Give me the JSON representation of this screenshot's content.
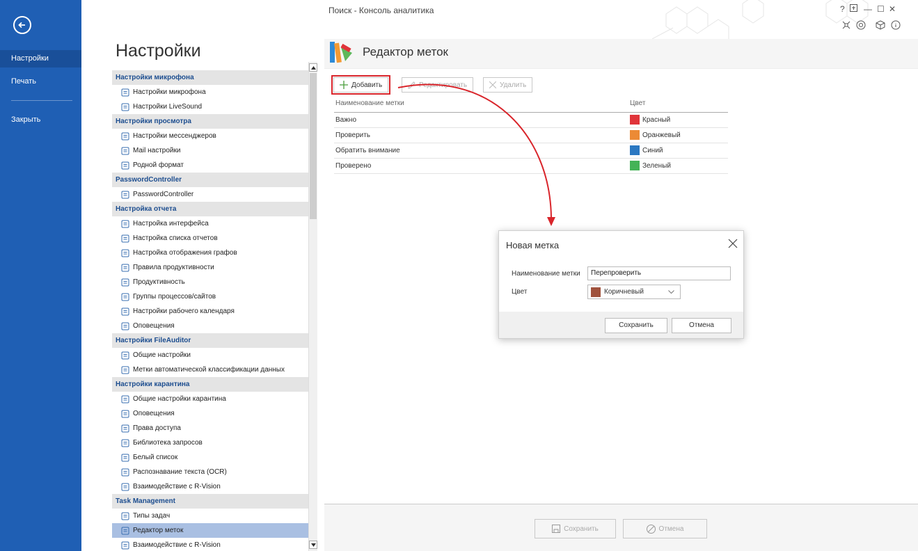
{
  "window": {
    "title": "Поиск - Консоль аналитика",
    "controls": [
      "?",
      "—",
      "☐",
      "✕"
    ]
  },
  "sidebar": {
    "items": [
      {
        "label": "Настройки"
      },
      {
        "label": "Печать"
      },
      {
        "label": "Закрыть"
      }
    ]
  },
  "settings": {
    "title": "Настройки",
    "tree": [
      {
        "type": "group",
        "label": "Настройки микрофона"
      },
      {
        "type": "item",
        "label": "Настройки микрофона",
        "icon": "microphone-icon"
      },
      {
        "type": "item",
        "label": "Настройки LiveSound",
        "icon": "livesound-icon"
      },
      {
        "type": "group",
        "label": "Настройки просмотра"
      },
      {
        "type": "item",
        "label": "Настройки мессенджеров",
        "icon": "messenger-icon"
      },
      {
        "type": "item",
        "label": "Mail настройки",
        "icon": "mail-icon"
      },
      {
        "type": "item",
        "label": "Родной формат",
        "icon": "format-icon"
      },
      {
        "type": "group",
        "label": "PasswordController"
      },
      {
        "type": "item",
        "label": "PasswordController",
        "icon": "lock-icon"
      },
      {
        "type": "group",
        "label": "Настройка отчета"
      },
      {
        "type": "item",
        "label": "Настройка интерфейса",
        "icon": "interface-icon"
      },
      {
        "type": "item",
        "label": "Настройка списка отчетов",
        "icon": "report-list-icon"
      },
      {
        "type": "item",
        "label": "Настройка отображения графов",
        "icon": "graph-icon"
      },
      {
        "type": "item",
        "label": "Правила продуктивности",
        "icon": "rules-icon"
      },
      {
        "type": "item",
        "label": "Продуктивность",
        "icon": "clock-icon"
      },
      {
        "type": "item",
        "label": "Группы процессов/сайтов",
        "icon": "groups-icon"
      },
      {
        "type": "item",
        "label": "Настройки рабочего календаря",
        "icon": "calendar-icon"
      },
      {
        "type": "item",
        "label": "Оповещения",
        "icon": "notification-icon"
      },
      {
        "type": "group",
        "label": "Настройки FileAuditor"
      },
      {
        "type": "item",
        "label": "Общие настройки",
        "icon": "settings-icon"
      },
      {
        "type": "item",
        "label": "Метки автоматической классификации данных",
        "icon": "tag-icon"
      },
      {
        "type": "group",
        "label": "Настройки карантина"
      },
      {
        "type": "item",
        "label": "Общие настройки карантина",
        "icon": "quarantine-icon"
      },
      {
        "type": "item",
        "label": "Оповещения",
        "icon": "notification-icon"
      },
      {
        "type": "item",
        "label": "Права доступа",
        "icon": "access-icon"
      },
      {
        "type": "item",
        "label": "Библиотека запросов",
        "icon": "library-icon"
      },
      {
        "type": "item",
        "label": "Белый список",
        "icon": "whitelist-icon"
      },
      {
        "type": "item",
        "label": "Распознавание текста (OCR)",
        "icon": "ocr-icon"
      },
      {
        "type": "item",
        "label": "Взаимодействие с R-Vision",
        "icon": "rvision-icon"
      },
      {
        "type": "group",
        "label": "Task Management"
      },
      {
        "type": "item",
        "label": "Типы задач",
        "icon": "task-types-icon"
      },
      {
        "type": "item",
        "label": "Редактор меток",
        "icon": "label-editor-icon",
        "selected": true
      },
      {
        "type": "item",
        "label": "Взаимодействие с R-Vision",
        "icon": "rvision-icon"
      }
    ]
  },
  "editor": {
    "title": "Редактор меток",
    "toolbar": {
      "add": "Добавить",
      "edit": "Редактировать",
      "delete": "Удалить"
    },
    "table": {
      "headers": [
        "Наименование метки",
        "Цвет"
      ],
      "rows": [
        {
          "name": "Важно",
          "color_name": "Красный",
          "color": "#e0343a"
        },
        {
          "name": "Проверить",
          "color_name": "Оранжевый",
          "color": "#ec8a35"
        },
        {
          "name": "Обратить внимание",
          "color_name": "Синий",
          "color": "#2b78c2"
        },
        {
          "name": "Проверено",
          "color_name": "Зеленый",
          "color": "#44b357"
        }
      ]
    },
    "footer": {
      "save": "Сохранить",
      "cancel": "Отмена"
    }
  },
  "dialog": {
    "title": "Новая метка",
    "name_label": "Наименование метки",
    "name_value": "Перепроверить",
    "color_label": "Цвет",
    "color_value": "Коричневый",
    "color_swatch": "#a0523d",
    "save": "Сохранить",
    "cancel": "Отмена"
  },
  "colors": {
    "accent": "#1f5fb4",
    "highlight": "#d9252b"
  }
}
